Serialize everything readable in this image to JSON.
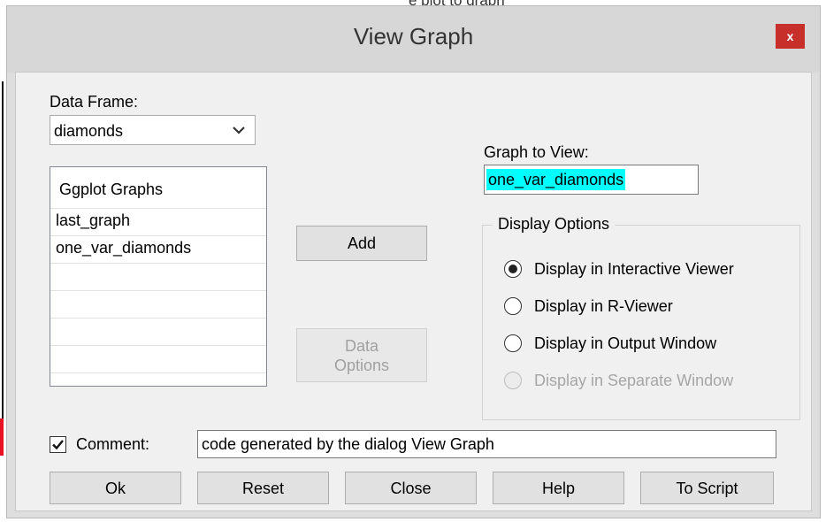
{
  "background_text": "e plot to graph",
  "window": {
    "title": "View Graph",
    "close_glyph": "x"
  },
  "data_frame": {
    "label": "Data Frame:",
    "selected": "diamonds"
  },
  "graphs_list": {
    "header": "Ggplot Graphs",
    "items": [
      "last_graph",
      "one_var_diamonds",
      "",
      "",
      "",
      ""
    ]
  },
  "buttons": {
    "add": "Add",
    "data_options_line1": "Data",
    "data_options_line2": "Options"
  },
  "graph_to_view": {
    "label": "Graph to View:",
    "value": "one_var_diamonds"
  },
  "display_options": {
    "title": "Display Options",
    "options": [
      {
        "label": "Display in Interactive Viewer",
        "checked": true,
        "enabled": true
      },
      {
        "label": "Display in R-Viewer",
        "checked": false,
        "enabled": true
      },
      {
        "label": "Display in Output Window",
        "checked": false,
        "enabled": true
      },
      {
        "label": "Display in Separate Window",
        "checked": false,
        "enabled": false
      }
    ]
  },
  "comment": {
    "checked": true,
    "label": "Comment:",
    "value": "code generated by the dialog View Graph"
  },
  "footer_buttons": {
    "ok": "Ok",
    "reset": "Reset",
    "close": "Close",
    "help": "Help",
    "to_script": "To Script"
  },
  "colors": {
    "selection_highlight": "#00ffff",
    "close_button": "#c7302a",
    "titlebar": "#d7d7d7",
    "client": "#f0f0f0"
  }
}
